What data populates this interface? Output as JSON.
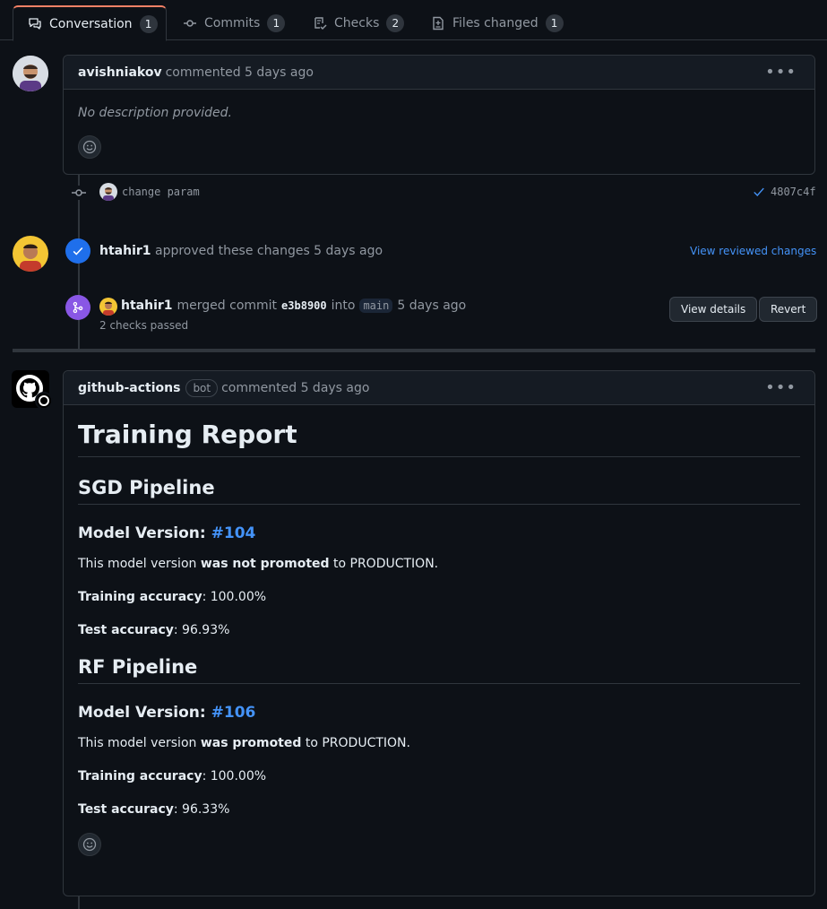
{
  "tabs": [
    {
      "label": "Conversation",
      "count": "1"
    },
    {
      "label": "Commits",
      "count": "1"
    },
    {
      "label": "Checks",
      "count": "2"
    },
    {
      "label": "Files changed",
      "count": "1"
    }
  ],
  "comment1": {
    "author": "avishniakov",
    "action": "commented 5 days ago",
    "body": "No description provided."
  },
  "commit": {
    "message": "change param",
    "sha": "4807c4f"
  },
  "approval": {
    "author": "htahir1",
    "action": "approved these changes 5 days ago",
    "link": "View reviewed changes"
  },
  "merge": {
    "author": "htahir1",
    "pre": "merged commit",
    "sha": "e3b8900",
    "into": "into",
    "branch": "main",
    "time": "5 days ago",
    "checks": "2 checks passed",
    "view_details": "View details",
    "revert": "Revert"
  },
  "comment2": {
    "author": "github-actions",
    "badge": "bot",
    "action": "commented 5 days ago"
  },
  "report": {
    "title": "Training Report",
    "sgd": {
      "heading": "SGD Pipeline",
      "mv_label": "Model Version:",
      "mv_link": "#104",
      "promo_pre": "This model version",
      "promo_bold": "was not promoted",
      "promo_post": "to PRODUCTION.",
      "train_label": "Training accuracy",
      "train_value": ": 100.00%",
      "test_label": "Test accuracy",
      "test_value": ": 96.93%"
    },
    "rf": {
      "heading": "RF Pipeline",
      "mv_label": "Model Version:",
      "mv_link": "#106",
      "promo_pre": "This model version",
      "promo_bold": "was promoted",
      "promo_post": "to PRODUCTION.",
      "train_label": "Training accuracy",
      "train_value": ": 100.00%",
      "test_label": "Test accuracy",
      "test_value": ": 96.33%"
    }
  },
  "colors": {
    "bg": "#0d1117",
    "border": "#30363d",
    "link": "#4493f8",
    "approve": "#1f6feb",
    "merged": "#8957e5",
    "muted": "#9198a1"
  }
}
